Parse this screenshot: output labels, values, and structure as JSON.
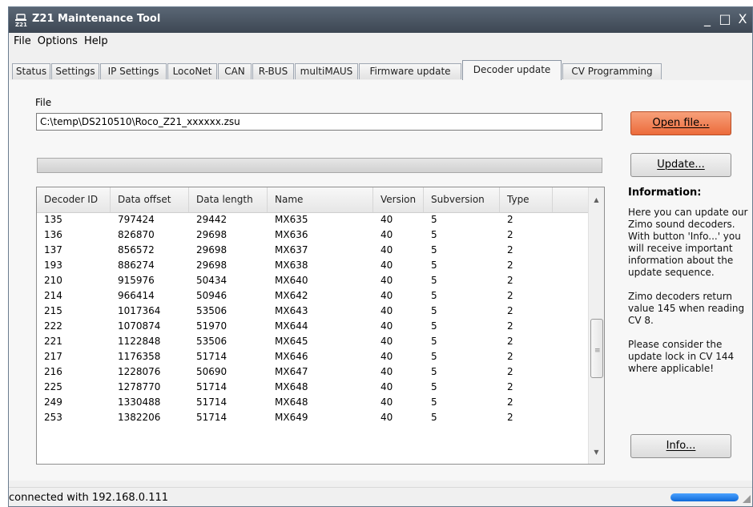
{
  "window": {
    "title": "Z21 Maintenance Tool",
    "minimize_glyph": "_",
    "maximize_glyph": "□",
    "close_glyph": "X"
  },
  "menu": [
    "File",
    "Options",
    "Help"
  ],
  "tabs": [
    "Status",
    "Settings",
    "IP Settings",
    "LocoNet",
    "CAN",
    "R-BUS",
    "multiMAUS",
    "Firmware update",
    "Decoder update",
    "CV Programming"
  ],
  "active_tab": "Decoder update",
  "file": {
    "label": "File",
    "path": "C:\\temp\\DS210510\\Roco_Z21_xxxxxx.zsu"
  },
  "buttons": {
    "open_file": "Open file...",
    "update": "Update...",
    "info": "Info..."
  },
  "progress": 0,
  "table": {
    "columns": [
      "Decoder ID",
      "Data offset",
      "Data length",
      "Name",
      "Version",
      "Subversion",
      "Type"
    ],
    "rows": [
      [
        "135",
        "797424",
        "29442",
        "MX635",
        "40",
        "5",
        "2"
      ],
      [
        "136",
        "826870",
        "29698",
        "MX636",
        "40",
        "5",
        "2"
      ],
      [
        "137",
        "856572",
        "29698",
        "MX637",
        "40",
        "5",
        "2"
      ],
      [
        "193",
        "886274",
        "29698",
        "MX638",
        "40",
        "5",
        "2"
      ],
      [
        "210",
        "915976",
        "50434",
        "MX640",
        "40",
        "5",
        "2"
      ],
      [
        "214",
        "966414",
        "50946",
        "MX642",
        "40",
        "5",
        "2"
      ],
      [
        "215",
        "1017364",
        "53506",
        "MX643",
        "40",
        "5",
        "2"
      ],
      [
        "222",
        "1070874",
        "51970",
        "MX644",
        "40",
        "5",
        "2"
      ],
      [
        "221",
        "1122848",
        "53506",
        "MX645",
        "40",
        "5",
        "2"
      ],
      [
        "217",
        "1176358",
        "51714",
        "MX646",
        "40",
        "5",
        "2"
      ],
      [
        "216",
        "1228076",
        "50690",
        "MX647",
        "40",
        "5",
        "2"
      ],
      [
        "225",
        "1278770",
        "51714",
        "MX648",
        "40",
        "5",
        "2"
      ],
      [
        "249",
        "1330488",
        "51714",
        "MX648",
        "40",
        "5",
        "2"
      ],
      [
        "253",
        "1382206",
        "51714",
        "MX649",
        "40",
        "5",
        "2"
      ]
    ]
  },
  "information": {
    "title": "Information:",
    "paragraphs": [
      "Here you can update our Zimo sound decoders. With button 'Info...' you will receive important information about the update sequence.",
      "Zimo decoders return value 145 when reading CV 8.",
      "Please consider the update lock in CV 144 where applicable!"
    ]
  },
  "status": {
    "text": "connected with 192.168.0.111"
  },
  "colors": {
    "accent_button": "#ec6b3b",
    "titlebar": "#3d4753",
    "status_indicator": "#0f6ad8"
  }
}
